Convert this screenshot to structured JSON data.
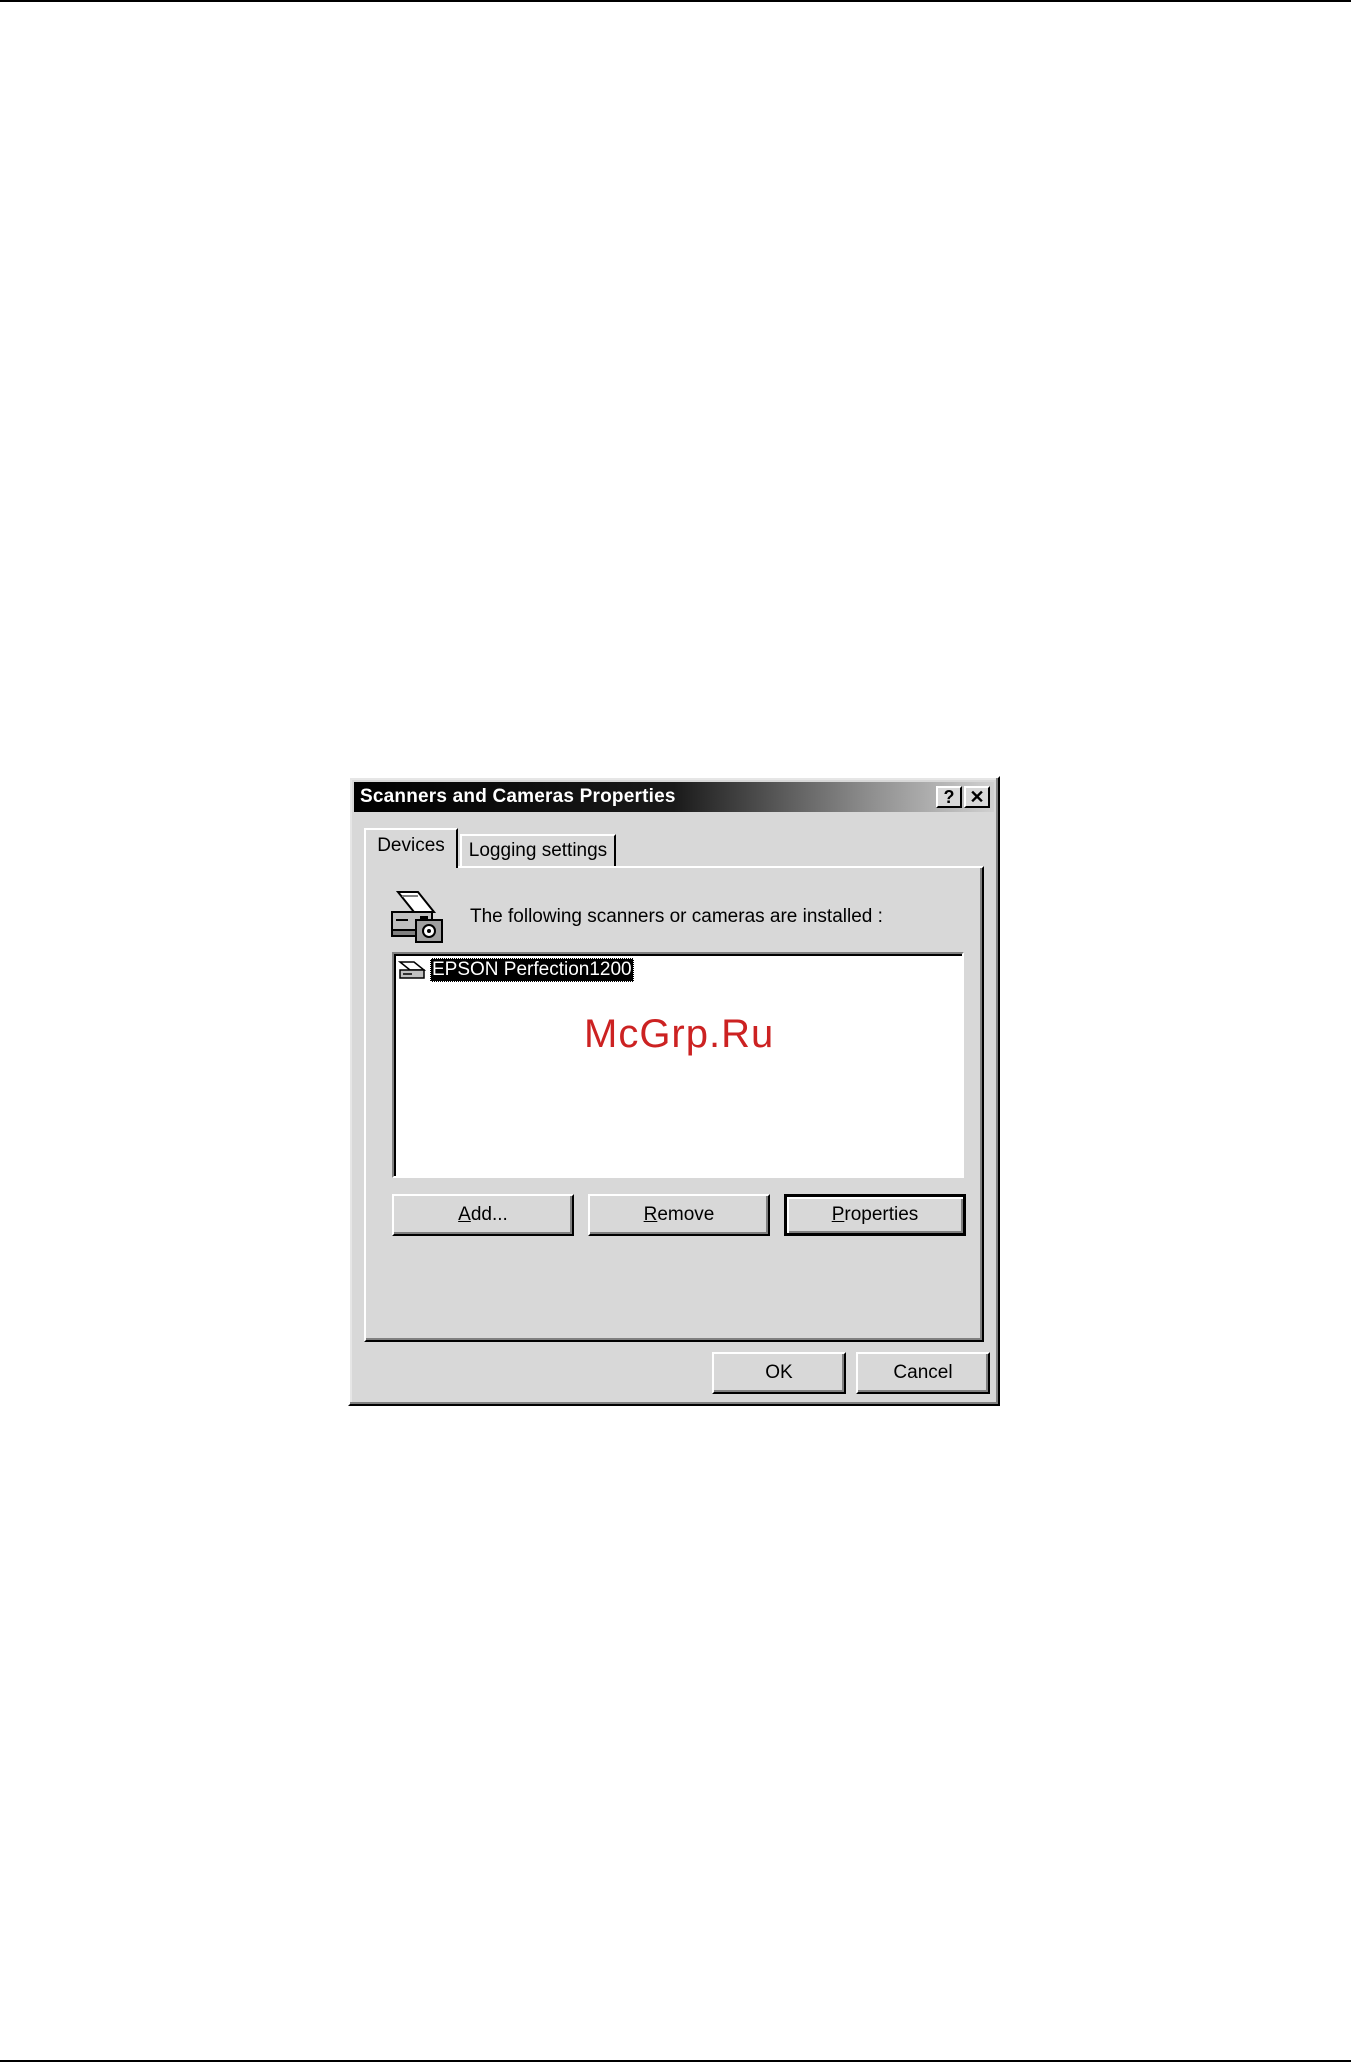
{
  "window": {
    "title": "Scanners and Cameras Properties",
    "help_label": "?",
    "close_label": "✕"
  },
  "tabs": [
    {
      "label": "Devices",
      "selected": true
    },
    {
      "label": "Logging settings",
      "selected": false
    }
  ],
  "devices_panel": {
    "caption": "The following scanners or cameras are installed :",
    "icon": "scanner-camera-icon",
    "devices": [
      {
        "label": "EPSON Perfection1200",
        "icon": "scanner-icon",
        "selected": true
      }
    ],
    "watermark": "McGrp.Ru",
    "buttons": {
      "add": {
        "mnemonic": "A",
        "rest": "dd..."
      },
      "remove": {
        "mnemonic": "R",
        "rest": "emove"
      },
      "properties": {
        "mnemonic": "P",
        "rest": "roperties"
      }
    }
  },
  "footer": {
    "ok_label": "OK",
    "cancel_label": "Cancel"
  },
  "colors": {
    "face": "#d8d8d8",
    "title_start": "#000000",
    "title_end": "#d0d0d0",
    "selection": "#000000",
    "watermark": "#cc2222"
  }
}
